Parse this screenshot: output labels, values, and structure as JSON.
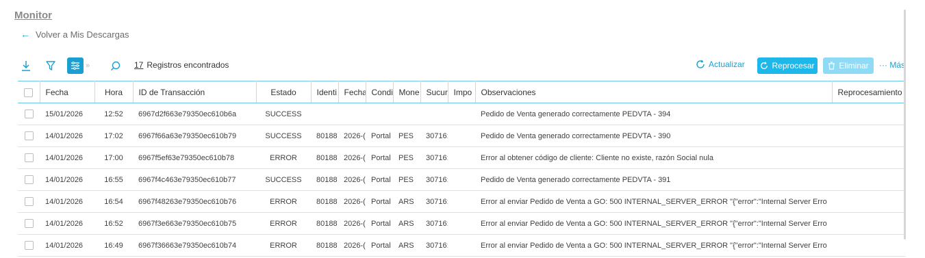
{
  "page": {
    "title": "Monitor",
    "back_label": "Volver a Mis Descargas"
  },
  "toolbar": {
    "icons": [
      "download-icon",
      "filter-icon",
      "columns-icon",
      "chevron-right-icon",
      "search-icon"
    ],
    "records_count": "17",
    "records_label": "Registros encontrados",
    "refresh_label": "Actualizar",
    "reprocess_label": "Reprocesar",
    "delete_label": "Eliminar",
    "more_label": "Más",
    "colors": {
      "accent": "#1b9fd0",
      "button": "#1db7ea",
      "button_disabled": "#8fdaf4"
    }
  },
  "table": {
    "columns": [
      "Fecha",
      "Hora",
      "ID de Transacción",
      "Estado",
      "Identi",
      "Fecha",
      "Condi",
      "Mone",
      "Sucur",
      "Impo",
      "Observaciones",
      "Reprocesamiento"
    ],
    "rows": [
      [
        "15/01/2026",
        "12:52",
        "6967d2f663e79350ec610b6a",
        "SUCCESS",
        "",
        "",
        "",
        "",
        "",
        "",
        "Pedido de Venta generado correctamente PEDVTA - 394",
        ""
      ],
      [
        "14/01/2026",
        "17:02",
        "6967f66a63e79350ec610b79",
        "SUCCESS",
        "80188",
        "2026-(",
        "Portal",
        "PES",
        "30716:",
        "",
        "Pedido de Venta generado correctamente PEDVTA - 390",
        ""
      ],
      [
        "14/01/2026",
        "17:00",
        "6967f5ef63e79350ec610b78",
        "ERROR",
        "80188",
        "2026-(",
        "Portal",
        "PES",
        "30716:",
        "",
        "Error al obtener código de cliente: Cliente no existe, razón Social nula",
        ""
      ],
      [
        "14/01/2026",
        "16:55",
        "6967f4c463e79350ec610b77",
        "SUCCESS",
        "80188",
        "2026-(",
        "Portal",
        "PES",
        "30716:",
        "",
        "Pedido de Venta generado correctamente PEDVTA - 391",
        ""
      ],
      [
        "14/01/2026",
        "16:54",
        "6967f48263e79350ec610b76",
        "ERROR",
        "80188",
        "2026-(",
        "Portal",
        "ARS",
        "30716:",
        "",
        "Error al enviar Pedido de Venta a GO: 500 INTERNAL_SERVER_ERROR \"{\"error\":\"Internal Server Erro",
        ""
      ],
      [
        "14/01/2026",
        "16:52",
        "6967f3e663e79350ec610b75",
        "ERROR",
        "80188",
        "2026-(",
        "Portal",
        "ARS",
        "30716:",
        "",
        "Error al enviar Pedido de Venta a GO: 500 INTERNAL_SERVER_ERROR \"{\"error\":\"Internal Server Erro",
        ""
      ],
      [
        "14/01/2026",
        "16:49",
        "6967f36663e79350ec610b74",
        "ERROR",
        "80188",
        "2026-(",
        "Portal",
        "ARS",
        "30716:",
        "",
        "Error al enviar Pedido de Venta a GO: 500 INTERNAL_SERVER_ERROR \"{\"error\":\"Internal Server Erro",
        ""
      ]
    ]
  }
}
